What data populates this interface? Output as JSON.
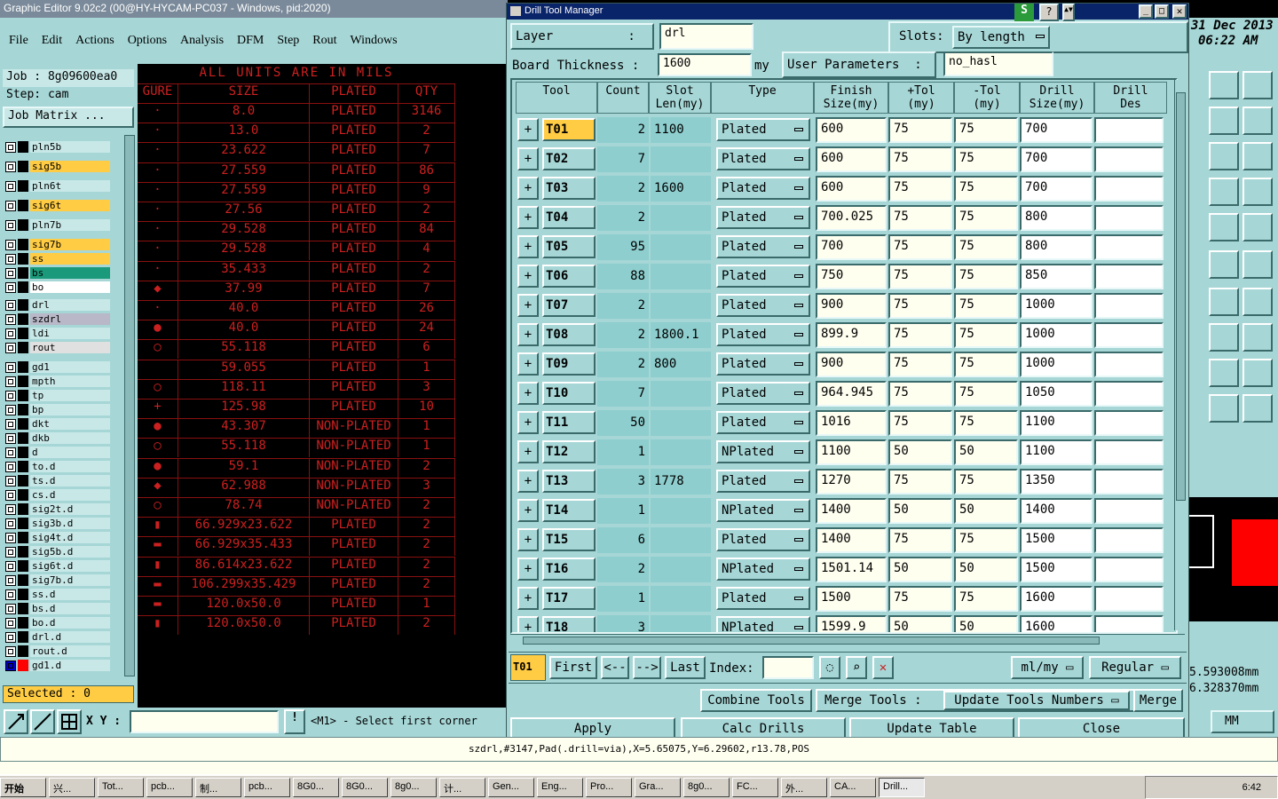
{
  "main_window": {
    "title": "Graphic Editor 9.02c2 (00@HY-HYCAM-PC037 - Windows, pid:2020)",
    "menu": [
      "File",
      "Edit",
      "Actions",
      "Options",
      "Analysis",
      "DFM",
      "Step",
      "Rout",
      "Windows"
    ],
    "date": "31 Dec 2013",
    "time": "06:22 AM"
  },
  "job_panel": {
    "job": "Job : 8g09600ea0",
    "step": "Step: cam",
    "job_matrix": "Job Matrix ...",
    "selected": "Selected : 0"
  },
  "layers": [
    {
      "name": "pln5b",
      "color": "#c8e8e8"
    },
    {
      "name": "sig5b",
      "color": "#ffcc44"
    },
    {
      "name": "pln6t",
      "color": "#c8e8e8"
    },
    {
      "name": "sig6t",
      "color": "#ffcc44"
    },
    {
      "name": "pln7b",
      "color": "#c8e8e8"
    },
    {
      "name": "sig7b",
      "color": "#ffcc44"
    },
    {
      "name": "ss",
      "color": "#ffcc44"
    },
    {
      "name": "bs",
      "color": "#1a9a7a"
    },
    {
      "name": "bo",
      "color": "#ffffff"
    },
    {
      "name": "drl",
      "color": "#c8e8e8"
    },
    {
      "name": "szdrl",
      "color": "#b8b8c8"
    },
    {
      "name": "ldi",
      "color": "#c8e8e8"
    },
    {
      "name": "rout",
      "color": "#e0e0e0"
    },
    {
      "name": "gd1",
      "color": "#c8e8e8"
    },
    {
      "name": "mpth",
      "color": "#c8e8e8"
    },
    {
      "name": "tp",
      "color": "#c8e8e8"
    },
    {
      "name": "bp",
      "color": "#c8e8e8"
    },
    {
      "name": "dkt",
      "color": "#c8e8e8"
    },
    {
      "name": "dkb",
      "color": "#c8e8e8"
    },
    {
      "name": "d",
      "color": "#c8e8e8"
    },
    {
      "name": "to.d",
      "color": "#c8e8e8"
    },
    {
      "name": "ts.d",
      "color": "#c8e8e8"
    },
    {
      "name": "cs.d",
      "color": "#c8e8e8"
    },
    {
      "name": "sig2t.d",
      "color": "#c8e8e8"
    },
    {
      "name": "sig3b.d",
      "color": "#c8e8e8"
    },
    {
      "name": "sig4t.d",
      "color": "#c8e8e8"
    },
    {
      "name": "sig5b.d",
      "color": "#c8e8e8"
    },
    {
      "name": "sig6t.d",
      "color": "#c8e8e8"
    },
    {
      "name": "sig7b.d",
      "color": "#c8e8e8"
    },
    {
      "name": "ss.d",
      "color": "#c8e8e8"
    },
    {
      "name": "bs.d",
      "color": "#c8e8e8"
    },
    {
      "name": "bo.d",
      "color": "#c8e8e8"
    },
    {
      "name": "drl.d",
      "color": "#c8e8e8"
    },
    {
      "name": "rout.d",
      "color": "#c8e8e8"
    },
    {
      "name": "gd1.d",
      "color": "#c8e8e8"
    }
  ],
  "units_table": {
    "banner": "ALL UNITS ARE IN MILS",
    "headers": [
      "GURE",
      "SIZE",
      "PLATED",
      "QTY"
    ],
    "rows": [
      [
        "·",
        "8.0",
        "PLATED",
        "3146"
      ],
      [
        "·",
        "13.0",
        "PLATED",
        "2"
      ],
      [
        "·",
        "23.622",
        "PLATED",
        "7"
      ],
      [
        "·",
        "27.559",
        "PLATED",
        "86"
      ],
      [
        "·",
        "27.559",
        "PLATED",
        "9"
      ],
      [
        "·",
        "27.56",
        "PLATED",
        "2"
      ],
      [
        "·",
        "29.528",
        "PLATED",
        "84"
      ],
      [
        "·",
        "29.528",
        "PLATED",
        "4"
      ],
      [
        "·",
        "35.433",
        "PLATED",
        "2"
      ],
      [
        "◆",
        "37.99",
        "PLATED",
        "7"
      ],
      [
        "·",
        "40.0",
        "PLATED",
        "26"
      ],
      [
        "●",
        "40.0",
        "PLATED",
        "24"
      ],
      [
        "○",
        "55.118",
        "PLATED",
        "6"
      ],
      [
        "",
        "59.055",
        "PLATED",
        "1"
      ],
      [
        "○",
        "118.11",
        "PLATED",
        "3"
      ],
      [
        "+",
        "125.98",
        "PLATED",
        "10"
      ],
      [
        "●",
        "43.307",
        "NON-PLATED",
        "1"
      ],
      [
        "○",
        "55.118",
        "NON-PLATED",
        "1"
      ],
      [
        "●",
        "59.1",
        "NON-PLATED",
        "2"
      ],
      [
        "◆",
        "62.988",
        "NON-PLATED",
        "3"
      ],
      [
        "○",
        "78.74",
        "NON-PLATED",
        "2"
      ],
      [
        "▮",
        "66.929x23.622",
        "PLATED",
        "2"
      ],
      [
        "▬",
        "66.929x35.433",
        "PLATED",
        "2"
      ],
      [
        "▮",
        "86.614x23.622",
        "PLATED",
        "2"
      ],
      [
        "▬",
        "106.299x35.429",
        "PLATED",
        "2"
      ],
      [
        "▬",
        "120.0x50.0",
        "PLATED",
        "1"
      ],
      [
        "▮",
        "120.0x50.0",
        "PLATED",
        "2"
      ]
    ]
  },
  "status": {
    "xy_label": "X Y :",
    "prompt": "<M1> - Select first corner",
    "bottom_line": "szdrl,#3147,Pad(.drill=via),X=5.65075,Y=6.29602,r13.78,POS",
    "coord1": "5.593008mm",
    "coord2": "6.328370mm",
    "units_select": "MM"
  },
  "dialog": {
    "title": "Drill Tool Manager",
    "layer_label": "Layer          :",
    "layer_value": "drl",
    "slots_label": "Slots:",
    "slots_value": "By length",
    "board_thickness_label": "Board Thickness  :",
    "board_thickness_value": "1600",
    "board_thickness_unit": "my",
    "user_params_label": "User Parameters  :",
    "user_params_value": "no_hasl",
    "columns": [
      "Tool",
      "Count",
      "Slot\nLen(my)",
      "Type",
      "Finish\nSize(my)",
      "+Tol\n(my)",
      "-Tol\n(my)",
      "Drill\nSize(my)",
      "Drill\nDes"
    ],
    "rows": [
      {
        "tool": "T01",
        "count": "2",
        "slot": "1100",
        "type": "Plated",
        "finish": "600",
        "ptol": "75",
        "mtol": "75",
        "drill": "700",
        "des": ""
      },
      {
        "tool": "T02",
        "count": "7",
        "slot": "",
        "type": "Plated",
        "finish": "600",
        "ptol": "75",
        "mtol": "75",
        "drill": "700",
        "des": ""
      },
      {
        "tool": "T03",
        "count": "2",
        "slot": "1600",
        "type": "Plated",
        "finish": "600",
        "ptol": "75",
        "mtol": "75",
        "drill": "700",
        "des": ""
      },
      {
        "tool": "T04",
        "count": "2",
        "slot": "",
        "type": "Plated",
        "finish": "700.025",
        "ptol": "75",
        "mtol": "75",
        "drill": "800",
        "des": ""
      },
      {
        "tool": "T05",
        "count": "95",
        "slot": "",
        "type": "Plated",
        "finish": "700",
        "ptol": "75",
        "mtol": "75",
        "drill": "800",
        "des": ""
      },
      {
        "tool": "T06",
        "count": "88",
        "slot": "",
        "type": "Plated",
        "finish": "750",
        "ptol": "75",
        "mtol": "75",
        "drill": "850",
        "des": ""
      },
      {
        "tool": "T07",
        "count": "2",
        "slot": "",
        "type": "Plated",
        "finish": "900",
        "ptol": "75",
        "mtol": "75",
        "drill": "1000",
        "des": ""
      },
      {
        "tool": "T08",
        "count": "2",
        "slot": "1800.1",
        "type": "Plated",
        "finish": "899.9",
        "ptol": "75",
        "mtol": "75",
        "drill": "1000",
        "des": ""
      },
      {
        "tool": "T09",
        "count": "2",
        "slot": "800",
        "type": "Plated",
        "finish": "900",
        "ptol": "75",
        "mtol": "75",
        "drill": "1000",
        "des": ""
      },
      {
        "tool": "T10",
        "count": "7",
        "slot": "",
        "type": "Plated",
        "finish": "964.945",
        "ptol": "75",
        "mtol": "75",
        "drill": "1050",
        "des": ""
      },
      {
        "tool": "T11",
        "count": "50",
        "slot": "",
        "type": "Plated",
        "finish": "1016",
        "ptol": "75",
        "mtol": "75",
        "drill": "1100",
        "des": ""
      },
      {
        "tool": "T12",
        "count": "1",
        "slot": "",
        "type": "NPlated",
        "finish": "1100",
        "ptol": "50",
        "mtol": "50",
        "drill": "1100",
        "des": ""
      },
      {
        "tool": "T13",
        "count": "3",
        "slot": "1778",
        "type": "Plated",
        "finish": "1270",
        "ptol": "75",
        "mtol": "75",
        "drill": "1350",
        "des": ""
      },
      {
        "tool": "T14",
        "count": "1",
        "slot": "",
        "type": "NPlated",
        "finish": "1400",
        "ptol": "50",
        "mtol": "50",
        "drill": "1400",
        "des": ""
      },
      {
        "tool": "T15",
        "count": "6",
        "slot": "",
        "type": "Plated",
        "finish": "1400",
        "ptol": "75",
        "mtol": "75",
        "drill": "1500",
        "des": ""
      },
      {
        "tool": "T16",
        "count": "2",
        "slot": "",
        "type": "NPlated",
        "finish": "1501.14",
        "ptol": "50",
        "mtol": "50",
        "drill": "1500",
        "des": ""
      },
      {
        "tool": "T17",
        "count": "1",
        "slot": "",
        "type": "Plated",
        "finish": "1500",
        "ptol": "75",
        "mtol": "75",
        "drill": "1600",
        "des": ""
      },
      {
        "tool": "T18",
        "count": "3",
        "slot": "",
        "type": "NPlated",
        "finish": "1599.9",
        "ptol": "50",
        "mtol": "50",
        "drill": "1600",
        "des": ""
      }
    ],
    "nav": {
      "current": "T01",
      "first": "First",
      "prev": "<--",
      "next": "-->",
      "last": "Last",
      "index_label": "Index:",
      "unit_select": "ml/my",
      "mode_select": "Regular"
    },
    "actions": {
      "combine": "Combine Tools",
      "merge_label": "Merge Tools :",
      "update_numbers": "Update Tools Numbers",
      "merge": "Merge"
    },
    "footer": {
      "apply": "Apply",
      "calc": "Calc Drills",
      "update": "Update Table",
      "close": "Close"
    }
  },
  "taskbar": {
    "start": "开始",
    "items": [
      "兴...",
      "Tot...",
      "pcb...",
      "制...",
      "pcb...",
      "8G0...",
      "8G0...",
      "8g0...",
      "计...",
      "Gen...",
      "Eng...",
      "Pro...",
      "Gra...",
      "8g0...",
      "FC...",
      "外...",
      "CA...",
      "Drill..."
    ],
    "clock": "6:42"
  },
  "colors": {
    "panel": "#a6d6d6",
    "accent_orange": "#ffcc44",
    "field": "#fffff0",
    "unit_red": "#cc2020"
  }
}
